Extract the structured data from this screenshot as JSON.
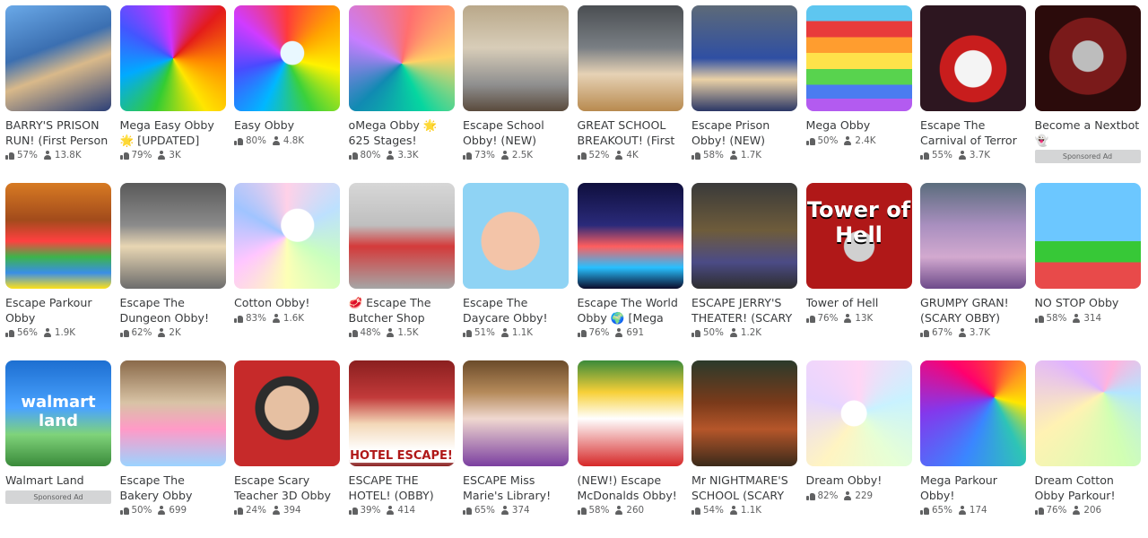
{
  "games": [
    {
      "title": "BARRY'S PRISON RUN! (First Person",
      "rating": "57%",
      "players": "13.8K",
      "bg": "linear-gradient(160deg,#6aa9e8 0%,#3b6fb1 40%,#d9b98a 60%,#2b3f77 100%)"
    },
    {
      "title": "Mega Easy Obby 🌟 [UPDATED]",
      "rating": "79%",
      "players": "3K",
      "bg": "conic-gradient(from 45deg,#e31b1b,#ff8a00,#ffe600,#33cc33,#00aaff,#4455ff,#cc33ff,#e31b1b)"
    },
    {
      "title": "Easy Obby",
      "rating": "80%",
      "players": "4.8K",
      "bg": "radial-gradient(circle at 55% 45%,#e9f8ff 0 14%,transparent 15%),conic-gradient(#ff3b3b,#ffa200,#fff200,#3bd13b,#00b7ff,#4a4aff,#d03bff,#ff3b3b)"
    },
    {
      "title": "oMega Obby 🌟 625 Stages!",
      "rating": "80%",
      "players": "3.3K",
      "bg": "conic-gradient(from 10deg at 50% 55%,#ff6f6f,#ffd166,#06d6a0,#118ab2,#c77dff,#ff6f6f)"
    },
    {
      "title": "Escape School Obby! (NEW)",
      "rating": "73%",
      "players": "2.5K",
      "bg": "linear-gradient(180deg,#b9a88a 0%,#d8cdb8 40%,#8f8f8f 75%,#5a4a3c 100%)"
    },
    {
      "title": "GREAT SCHOOL BREAKOUT! (First",
      "rating": "52%",
      "players": "4K",
      "bg": "linear-gradient(180deg,#4a4e52 0%,#7a7f84 40%,#e6d2b5 65%,#b88a4f 100%)"
    },
    {
      "title": "Escape Prison Obby! (NEW)",
      "rating": "58%",
      "players": "1.7K",
      "bg": "linear-gradient(180deg,#5d6a78 0%,#2f4fa3 50%,#ead1a6 70%,#2b3766 100%)"
    },
    {
      "title": "Mega Obby",
      "rating": "50%",
      "players": "2.4K",
      "bg": "linear-gradient(180deg,#5ec6f0 0 15%,#e83b3b 15% 30%,#ff9d2f 30% 45%,#ffe24a 45% 60%,#58d34e 60% 75%,#4a7cf0 75% 88%,#b35bf0 88% 100%)"
    },
    {
      "title": "Escape The Carnival of Terror",
      "rating": "55%",
      "players": "3.7K",
      "bg": "radial-gradient(circle at 50% 60%,#f4f4f4 0 22%,#c81d1d 23% 40%,#2d1620 41%)"
    },
    {
      "title": "Become a Nextbot 👻",
      "rating": "",
      "players": "",
      "bg": "radial-gradient(circle at 50% 48%,#bdbdbd 0 20%,#7a1a1a 21% 50%,#2b0b0b 51%)",
      "sponsored": "Sponsored Ad"
    },
    {
      "title": "Escape Parkour Obby",
      "rating": "56%",
      "players": "1.9K",
      "bg": "linear-gradient(180deg,#d77a23 0%,#a24b1b 35%,#ff4040 55%,#3cb44b 70%,#3a8ee6 85%,#ffe119 100%)"
    },
    {
      "title": "Escape The Dungeon Obby!",
      "rating": "62%",
      "players": "2K",
      "bg": "linear-gradient(180deg,#5a5a5a 0%,#8b8b8b 40%,#e8d6b3 60%,#6c6c6c 100%)"
    },
    {
      "title": "Cotton Obby!",
      "rating": "83%",
      "players": "1.6K",
      "bg": "radial-gradient(circle at 60% 40%,#ffffff 0 18%,transparent 19%),conic-gradient(#ffd1e8,#bde0fe,#caffbf,#fdffb6,#ffc6ff,#a0c4ff,#ffd1e8)"
    },
    {
      "title": "🥩 Escape The Butcher Shop",
      "rating": "48%",
      "players": "1.5K",
      "bg": "linear-gradient(180deg,#d7d7d7 0%,#bfbfbf 40%,#d43a3a 60%,#a6a6a6 100%)"
    },
    {
      "title": "Escape The Daycare Obby!",
      "rating": "51%",
      "players": "1.1K",
      "bg": "radial-gradient(circle at 45% 55%,#f3c4a8 0 35%,#8fd3f4 36%)"
    },
    {
      "title": "Escape The World Obby 🌍 [Mega",
      "rating": "76%",
      "players": "691",
      "bg": "linear-gradient(180deg,#0f0f3d 0%,#2a2a7a 40%,#ff5e5e 60%,#28c0ff 80%,#0b0b2a 100%)"
    },
    {
      "title": "ESCAPE JERRY'S THEATER! (SCARY",
      "rating": "50%",
      "players": "1.2K",
      "bg": "linear-gradient(180deg,#3a3a3a 0%,#6e5c3b 45%,#4b4b86 75%,#2d2d2d 100%)"
    },
    {
      "title": "Tower of Hell",
      "rating": "76%",
      "players": "13K",
      "bg": "radial-gradient(circle at 50% 60%,#d0d0d0 0 18%,#b01818 19%)",
      "label": "Tower of Hell"
    },
    {
      "title": "GRUMPY GRAN! (SCARY OBBY)",
      "rating": "67%",
      "players": "3.7K",
      "bg": "linear-gradient(180deg,#5b6d7d 0%,#a98fbf 40%,#d2a9cf 70%,#6d4a8a 100%)"
    },
    {
      "title": "NO STOP Obby",
      "rating": "58%",
      "players": "314",
      "bg": "linear-gradient(180deg,#6cc7ff 0 55%,#37c837 55% 75%,#e84a4a 75%)"
    },
    {
      "title": "Walmart Land",
      "rating": "",
      "players": "",
      "bg": "linear-gradient(180deg,#1d6fd1 0%,#4aa3ff 45%,#7fd37a 70%,#3a8a3a 100%)",
      "sponsored": "Sponsored Ad",
      "label": "walmart land"
    },
    {
      "title": "Escape The Bakery Obby",
      "rating": "50%",
      "players": "699",
      "bg": "linear-gradient(180deg,#8a6a4a 0%,#d8c3a5 40%,#ff9ac7 65%,#9bd3ff 100%)"
    },
    {
      "title": "Escape Scary Teacher 3D Obby",
      "rating": "24%",
      "players": "394",
      "bg": "radial-gradient(circle at 50% 45%,#e6c0a2 0 28%,#2c2c2c 29% 40%,#c62a2a 41%)"
    },
    {
      "title": "ESCAPE THE HOTEL! (OBBY)",
      "rating": "39%",
      "players": "414",
      "bg": "linear-gradient(180deg,#8a1f1f 0%,#c23a3a 35%,#f3d8b8 60%,#ffffff 85%,#8a1f1f 100%)",
      "label": "HOTEL ESCAPE!"
    },
    {
      "title": "ESCAPE Miss Marie's Library!",
      "rating": "65%",
      "players": "374",
      "bg": "linear-gradient(180deg,#6b4b2a 0%,#b58a5a 30%,#f0d8d0 55%,#7b3fa0 100%)"
    },
    {
      "title": "(NEW!) Escape McDonalds Obby!",
      "rating": "58%",
      "players": "260",
      "bg": "linear-gradient(180deg,#3a8a3a 0%,#f7d038 30%,#ffffff 55%,#d62828 100%)"
    },
    {
      "title": "Mr NIGHTMARE'S SCHOOL (SCARY",
      "rating": "54%",
      "players": "1.1K",
      "bg": "linear-gradient(180deg,#2b3a2b 0%,#7a3a1a 40%,#b5562a 65%,#3b2a1a 100%)"
    },
    {
      "title": "Dream Obby!",
      "rating": "82%",
      "players": "229",
      "bg": "radial-gradient(circle at 45% 50%,#ffffff 0 16%,transparent 17%),conic-gradient(#ffd6f5,#c9f2ff,#e6ffd6,#fff4c2,#e6d6ff,#ffd6f5)"
    },
    {
      "title": "Mega Parkour Obby!",
      "rating": "65%",
      "players": "174",
      "bg": "conic-gradient(from 0deg at 70% 35%,#ff3b3b,#ff9f1c,#ffe600,#2ec4b6,#3a86ff,#8338ec,#ff006e,#ff3b3b)"
    },
    {
      "title": "Dream Cotton Obby Parkour!",
      "rating": "76%",
      "players": "206",
      "bg": "conic-gradient(from 20deg at 65% 30%,#ffb3de,#b3e5ff,#d1ffb3,#fff2b3,#e0b3ff,#ffb3de)"
    }
  ]
}
